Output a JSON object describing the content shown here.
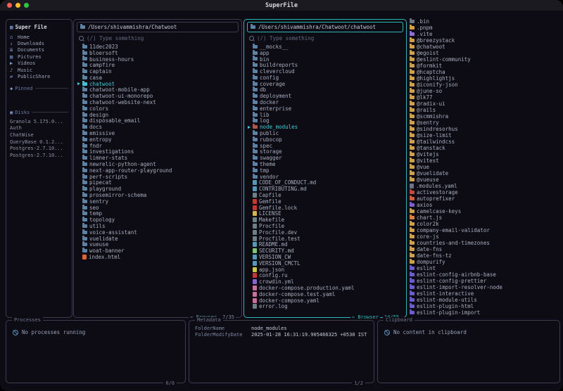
{
  "window": {
    "title": "SuperFile"
  },
  "sidebar": {
    "icon": "▦",
    "title": "Super File",
    "items": [
      {
        "icon": "⌂",
        "label": "Home"
      },
      {
        "icon": "↓",
        "label": "Downloads"
      },
      {
        "icon": "≣",
        "label": "Documents"
      },
      {
        "icon": "▨",
        "label": "Pictures"
      },
      {
        "icon": "▶",
        "label": "Videos"
      },
      {
        "icon": "♪",
        "label": "Music"
      },
      {
        "icon": "⇄",
        "label": "PublicShare"
      }
    ],
    "pinned_icon": "◆",
    "pinned_label": "Pinned",
    "disks_icon": "▣",
    "disks_label": "Disks",
    "disks": [
      {
        "label": "Granola 5.175.0..."
      },
      {
        "label": "Auth"
      },
      {
        "label": "ChatWise"
      },
      {
        "label": "QueryBase 0.1.2..."
      },
      {
        "label": "Postgres-2.7.10..."
      },
      {
        "label": "Postgres-2.7.10..."
      }
    ]
  },
  "panels": [
    {
      "path": "/Users/shivammishra/Chatwoot",
      "search_placeholder": "(/) Type something",
      "footer_label": "⇐ Browser",
      "counter": "7/35",
      "files": [
        {
          "n": "11dec2023"
        },
        {
          "n": "bloersoft"
        },
        {
          "n": "business-hours"
        },
        {
          "n": "campfire"
        },
        {
          "n": "captain"
        },
        {
          "n": "casa"
        },
        {
          "n": "chatwoot",
          "sel": true,
          "c": "#3fc3ce"
        },
        {
          "n": "chatwoot-mobile-app"
        },
        {
          "n": "chatwoot-ui-monorepo"
        },
        {
          "n": "chatwoot-website-next"
        },
        {
          "n": "colors"
        },
        {
          "n": "design"
        },
        {
          "n": "disposable_email"
        },
        {
          "n": "docs"
        },
        {
          "n": "emissive"
        },
        {
          "n": "entropy"
        },
        {
          "n": "fndr"
        },
        {
          "n": "investigations"
        },
        {
          "n": "limner-stats"
        },
        {
          "n": "newrelic-python-agent"
        },
        {
          "n": "next-app-router-playground"
        },
        {
          "n": "perf-scripts"
        },
        {
          "n": "pipecat"
        },
        {
          "n": "playground"
        },
        {
          "n": "prosemirror-schema"
        },
        {
          "n": "sentry"
        },
        {
          "n": "seo"
        },
        {
          "n": "temp"
        },
        {
          "n": "topology"
        },
        {
          "n": "utils"
        },
        {
          "n": "voice-assistant"
        },
        {
          "n": "vuelidate"
        },
        {
          "n": "vueuse"
        },
        {
          "n": "woat-banner"
        },
        {
          "n": "index.html",
          "t": "file",
          "c": "#e0642f"
        }
      ]
    },
    {
      "path": "/Users/shivammishra/Chatwoot/chatwoot",
      "search_placeholder": "(/) Type something",
      "footer_label": "⇐ Browser",
      "counter": "14/55",
      "files": [
        {
          "n": "__mocks__"
        },
        {
          "n": "app"
        },
        {
          "n": "bin"
        },
        {
          "n": "buildreports"
        },
        {
          "n": "clevercloud"
        },
        {
          "n": "config"
        },
        {
          "n": "coverage"
        },
        {
          "n": "db"
        },
        {
          "n": "deployment"
        },
        {
          "n": "docker"
        },
        {
          "n": "enterprise"
        },
        {
          "n": "lib"
        },
        {
          "n": "log"
        },
        {
          "n": "node_modules",
          "sel": true,
          "c": "#b0564a"
        },
        {
          "n": "public"
        },
        {
          "n": "rubocop"
        },
        {
          "n": "spec"
        },
        {
          "n": "storage"
        },
        {
          "n": "swagger"
        },
        {
          "n": "theme"
        },
        {
          "n": "tmp"
        },
        {
          "n": "vendor"
        },
        {
          "n": "CODE_OF_CONDUCT.md",
          "t": "file",
          "c": "#519aba"
        },
        {
          "n": "CONTRIBUTING.md",
          "t": "file",
          "c": "#519aba"
        },
        {
          "n": "Capfile",
          "t": "file",
          "c": "#6d8086"
        },
        {
          "n": "Gemfile",
          "t": "file",
          "c": "#cc342d"
        },
        {
          "n": "Gemfile.lock",
          "t": "file",
          "c": "#cc342d"
        },
        {
          "n": "LICENSE",
          "t": "file",
          "c": "#d5b44a"
        },
        {
          "n": "Makefile",
          "t": "file",
          "c": "#6d8086"
        },
        {
          "n": "Procfile",
          "t": "file",
          "c": "#6d8086"
        },
        {
          "n": "Procfile.dev",
          "t": "file",
          "c": "#6d8086"
        },
        {
          "n": "Procfile.test",
          "t": "file",
          "c": "#6d8086"
        },
        {
          "n": "README.md",
          "t": "file",
          "c": "#519aba"
        },
        {
          "n": "SECURITY.md",
          "t": "file",
          "c": "#7bc96f"
        },
        {
          "n": "VERSION_CW",
          "t": "file",
          "c": "#519aba"
        },
        {
          "n": "VERSION_CMCTL",
          "t": "file",
          "c": "#519aba"
        },
        {
          "n": "app.json",
          "t": "file",
          "c": "#cbcb41"
        },
        {
          "n": "config.ru",
          "t": "file",
          "c": "#cc342d"
        },
        {
          "n": "crowdin.yml",
          "t": "file",
          "c": "#8a63d2"
        },
        {
          "n": "docker-compose.production.yaml",
          "t": "file",
          "c": "#d16d9e"
        },
        {
          "n": "docker-compose.test.yaml",
          "t": "file",
          "c": "#d16d9e"
        },
        {
          "n": "docker-compose.yaml",
          "t": "file",
          "c": "#d16d9e"
        },
        {
          "n": "error.log",
          "t": "file",
          "c": "#6d8086"
        }
      ]
    }
  ],
  "preview": {
    "files": [
      {
        "n": ".bin",
        "c": "#6d7486"
      },
      {
        "n": ".pnpm",
        "c": "#d9a33c"
      },
      {
        "n": ".vite",
        "c": "#8f6fd8"
      },
      {
        "n": "@breezystack"
      },
      {
        "n": "@chatwoot"
      },
      {
        "n": "@egoist"
      },
      {
        "n": "@eslint-community"
      },
      {
        "n": "@formkit"
      },
      {
        "n": "@hcaptcha"
      },
      {
        "n": "@highlightjs"
      },
      {
        "n": "@iconify-json"
      },
      {
        "n": "@june-so"
      },
      {
        "n": "@lk77"
      },
      {
        "n": "@radix-ui"
      },
      {
        "n": "@rails"
      },
      {
        "n": "@scmmishra"
      },
      {
        "n": "@sentry"
      },
      {
        "n": "@sindresorhus"
      },
      {
        "n": "@size-limit"
      },
      {
        "n": "@tailwindcss"
      },
      {
        "n": "@tanstack"
      },
      {
        "n": "@vitejs"
      },
      {
        "n": "@vitest"
      },
      {
        "n": "@vue"
      },
      {
        "n": "@vuelidate"
      },
      {
        "n": "@vueuse"
      },
      {
        "n": ".modules.yaml",
        "t": "file",
        "c": "#6d7486"
      },
      {
        "n": "activestorage",
        "c": "#c24a3f"
      },
      {
        "n": "autoprefixer",
        "c": "#d45b3e"
      },
      {
        "n": "axios",
        "c": "#7f5fd0"
      },
      {
        "n": "camelcase-keys"
      },
      {
        "n": "chart.js",
        "c": "#e0813a"
      },
      {
        "n": "color2k"
      },
      {
        "n": "company-email-validator"
      },
      {
        "n": "core-js"
      },
      {
        "n": "countries-and-timezones"
      },
      {
        "n": "date-fns"
      },
      {
        "n": "date-fns-tz"
      },
      {
        "n": "dompurify"
      },
      {
        "n": "eslint",
        "c": "#6f5bd0"
      },
      {
        "n": "eslint-config-airbnb-base",
        "c": "#6f5bd0"
      },
      {
        "n": "eslint-config-prettier",
        "c": "#6f5bd0"
      },
      {
        "n": "eslint-import-resolver-node",
        "c": "#6f5bd0"
      },
      {
        "n": "eslint-interactive",
        "c": "#6f5bd0"
      },
      {
        "n": "eslint-module-utils",
        "c": "#6f5bd0"
      },
      {
        "n": "eslint-plugin-html",
        "c": "#6f5bd0"
      },
      {
        "n": "eslint-plugin-import",
        "c": "#6f5bd0"
      }
    ]
  },
  "processes": {
    "title": "Processes",
    "empty": "No processes running",
    "counter": "0/0"
  },
  "metadata": {
    "title": "Metadata",
    "counter": "1/2",
    "rows": [
      {
        "k": "FolderName",
        "v": "node_modules"
      },
      {
        "k": "FolderModifyDate",
        "v": "2025-01-28 16:31:19.905466325 +0530 IST"
      }
    ]
  },
  "clipboard": {
    "title": "Clipboard",
    "empty": "No content in clipboard"
  }
}
